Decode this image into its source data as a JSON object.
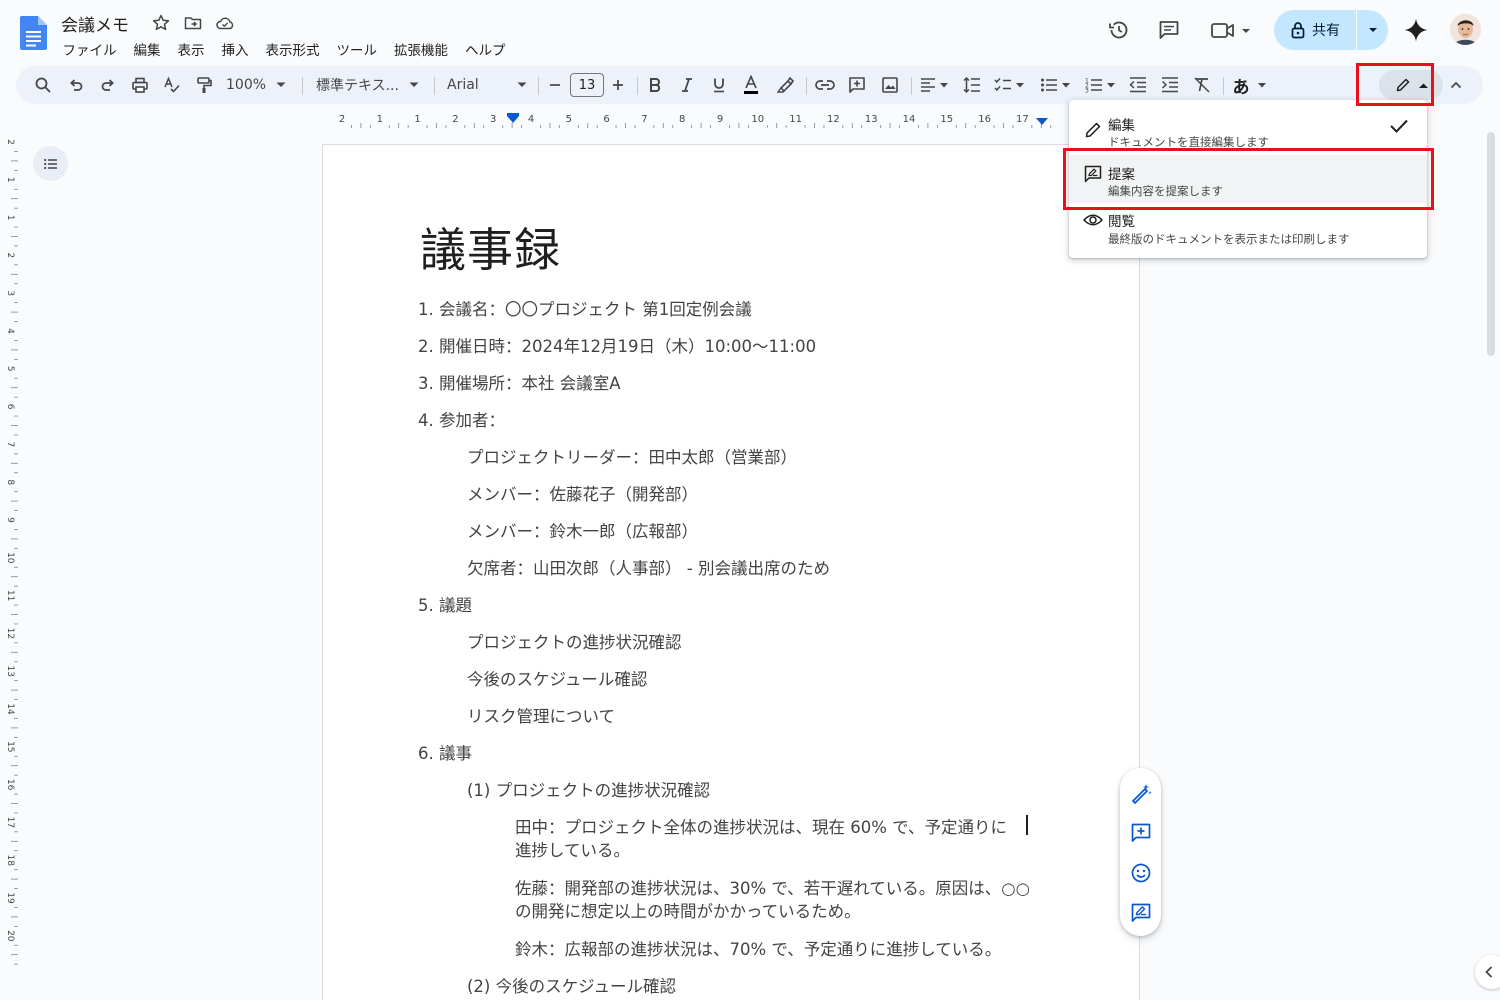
{
  "header": {
    "title": "会議メモ",
    "menu": [
      "ファイル",
      "編集",
      "表示",
      "挿入",
      "表示形式",
      "ツール",
      "拡張機能",
      "ヘルプ"
    ],
    "share_label": "共有"
  },
  "toolbar": {
    "zoom": "100%",
    "style": "標準テキス...",
    "font": "Arial",
    "font_size": "13",
    "input_tools": "あ"
  },
  "ruler": {
    "ticks": [
      "2",
      "1",
      "1",
      "2",
      "3",
      "4",
      "5",
      "6",
      "7",
      "8",
      "9",
      "10",
      "11",
      "12",
      "13",
      "14",
      "15",
      "16",
      "17"
    ],
    "vticks": [
      "2",
      "1",
      "1",
      "2",
      "3",
      "4",
      "5",
      "6",
      "7",
      "8",
      "9",
      "10",
      "11",
      "12",
      "13",
      "14",
      "15",
      "16",
      "17",
      "18",
      "19",
      "20"
    ]
  },
  "document": {
    "heading": "議事録",
    "lines": [
      "1. 会議名：〇〇プロジェクト 第1回定例会議",
      "2. 開催日時：2024年12月19日（木）10:00〜11:00",
      "3. 開催場所：本社 会議室A",
      "4. 参加者：",
      "プロジェクトリーダー：田中太郎（営業部）",
      "メンバー：佐藤花子（開発部）",
      "メンバー：鈴木一郎（広報部）",
      "欠席者：山田次郎（人事部） - 別会議出席のため",
      "5. 議題",
      "プロジェクトの進捗状況確認",
      "今後のスケジュール確認",
      "リスク管理について",
      "6. 議事",
      "(1) プロジェクトの進捗状況確認",
      "田中：プロジェクト全体の進捗状況は、現在 60% で、予定通りに",
      "進捗している。",
      "佐藤：開発部の進捗状況は、30% で、若干遅れている。原因は、○○",
      "の開発に想定以上の時間がかかっているため。",
      "鈴木：広報部の進捗状況は、70% で、予定通りに進捗している。",
      "(2) 今後のスケジュール確認"
    ]
  },
  "mode_menu": {
    "items": [
      {
        "label": "編集",
        "desc": "ドキュメントを直接編集します",
        "checked": true
      },
      {
        "label": "提案",
        "desc": "編集内容を提案します",
        "checked": false
      },
      {
        "label": "閲覧",
        "desc": "最終版のドキュメントを表示または印刷します",
        "checked": false
      }
    ]
  },
  "colors": {
    "accent": "#0b57d0",
    "share_bg": "#c2e7ff",
    "highlight": "#e8101c",
    "doc_blue": "#4285f4"
  }
}
